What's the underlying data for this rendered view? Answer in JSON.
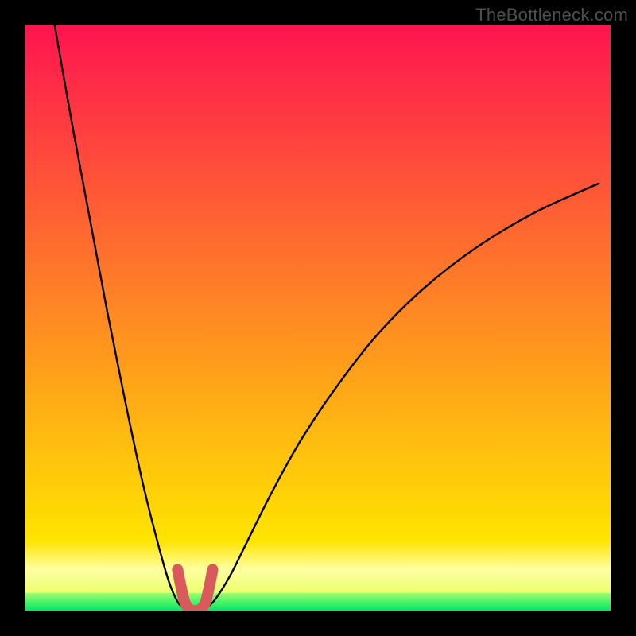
{
  "watermark": "TheBottleneck.com",
  "chart_data": {
    "type": "line",
    "title": "",
    "xlabel": "",
    "ylabel": "",
    "xlim": [
      0,
      100
    ],
    "ylim": [
      0,
      100
    ],
    "grid": false,
    "legend": null,
    "series": [
      {
        "name": "curve-left",
        "x": [
          5,
          8,
          11,
          14,
          17,
          20,
          22.5,
          24.5,
          26,
          27,
          27.8
        ],
        "y": [
          100,
          83,
          67,
          51,
          36,
          22,
          12,
          5,
          1.5,
          0.5,
          0
        ]
      },
      {
        "name": "curve-right",
        "x": [
          30.2,
          31,
          32.5,
          35,
          38,
          42,
          47,
          53,
          60,
          68,
          77,
          87,
          98
        ],
        "y": [
          0,
          0.5,
          2,
          6,
          12,
          20,
          29,
          38,
          47,
          55,
          62,
          68,
          73
        ]
      },
      {
        "name": "highlight-u",
        "x": [
          26.0,
          26.6,
          27.2,
          27.8,
          28.4,
          29.0,
          29.6,
          30.2,
          30.8,
          31.4,
          32.0
        ],
        "y": [
          7,
          4,
          1.5,
          0.5,
          0,
          0,
          0,
          0.5,
          1.5,
          4,
          7
        ]
      }
    ],
    "gradient_bands": [
      {
        "y_top": 100,
        "y_bottom": 12,
        "color_top": "#ff1450",
        "color_bottom": "#ffe400"
      },
      {
        "y_top": 12,
        "y_bottom": 7,
        "color_top": "#ffe400",
        "color_bottom": "#ffffa0"
      },
      {
        "y_top": 7,
        "y_bottom": 3,
        "color_top": "#ffffa0",
        "color_bottom": "#eaff6e"
      },
      {
        "y_top": 3,
        "y_bottom": 0,
        "color_top": "#9cff6e",
        "color_bottom": "#00e864"
      }
    ]
  }
}
